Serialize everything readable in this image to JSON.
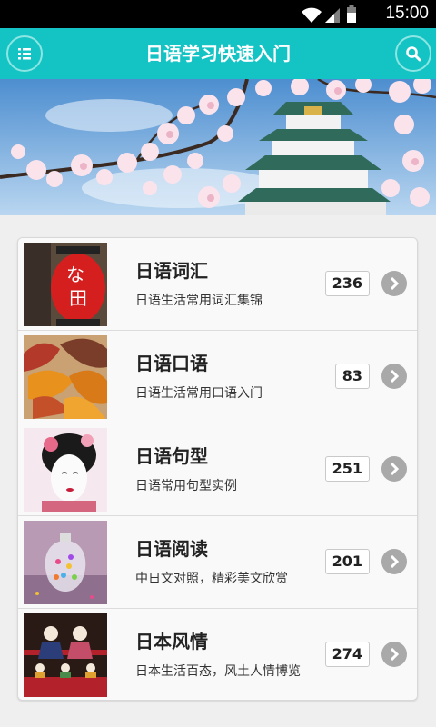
{
  "status_bar": {
    "time": "15:00"
  },
  "header": {
    "title": "日语学习快速入门",
    "menu_icon": "list-icon",
    "search_icon": "search-icon"
  },
  "colors": {
    "accent": "#14c3c3",
    "chevron": "#a9a9a9"
  },
  "list": {
    "items": [
      {
        "title": "日语词汇",
        "desc": "日语生活常用词汇集锦",
        "count": "236"
      },
      {
        "title": "日语口语",
        "desc": "日语生活常用口语入门",
        "count": "83"
      },
      {
        "title": "日语句型",
        "desc": "日语常用句型实例",
        "count": "251"
      },
      {
        "title": "日语阅读",
        "desc": "中日文对照，精彩美文欣赏",
        "count": "201"
      },
      {
        "title": "日本风情",
        "desc": "日本生活百态，风土人情博览",
        "count": "274"
      }
    ]
  }
}
